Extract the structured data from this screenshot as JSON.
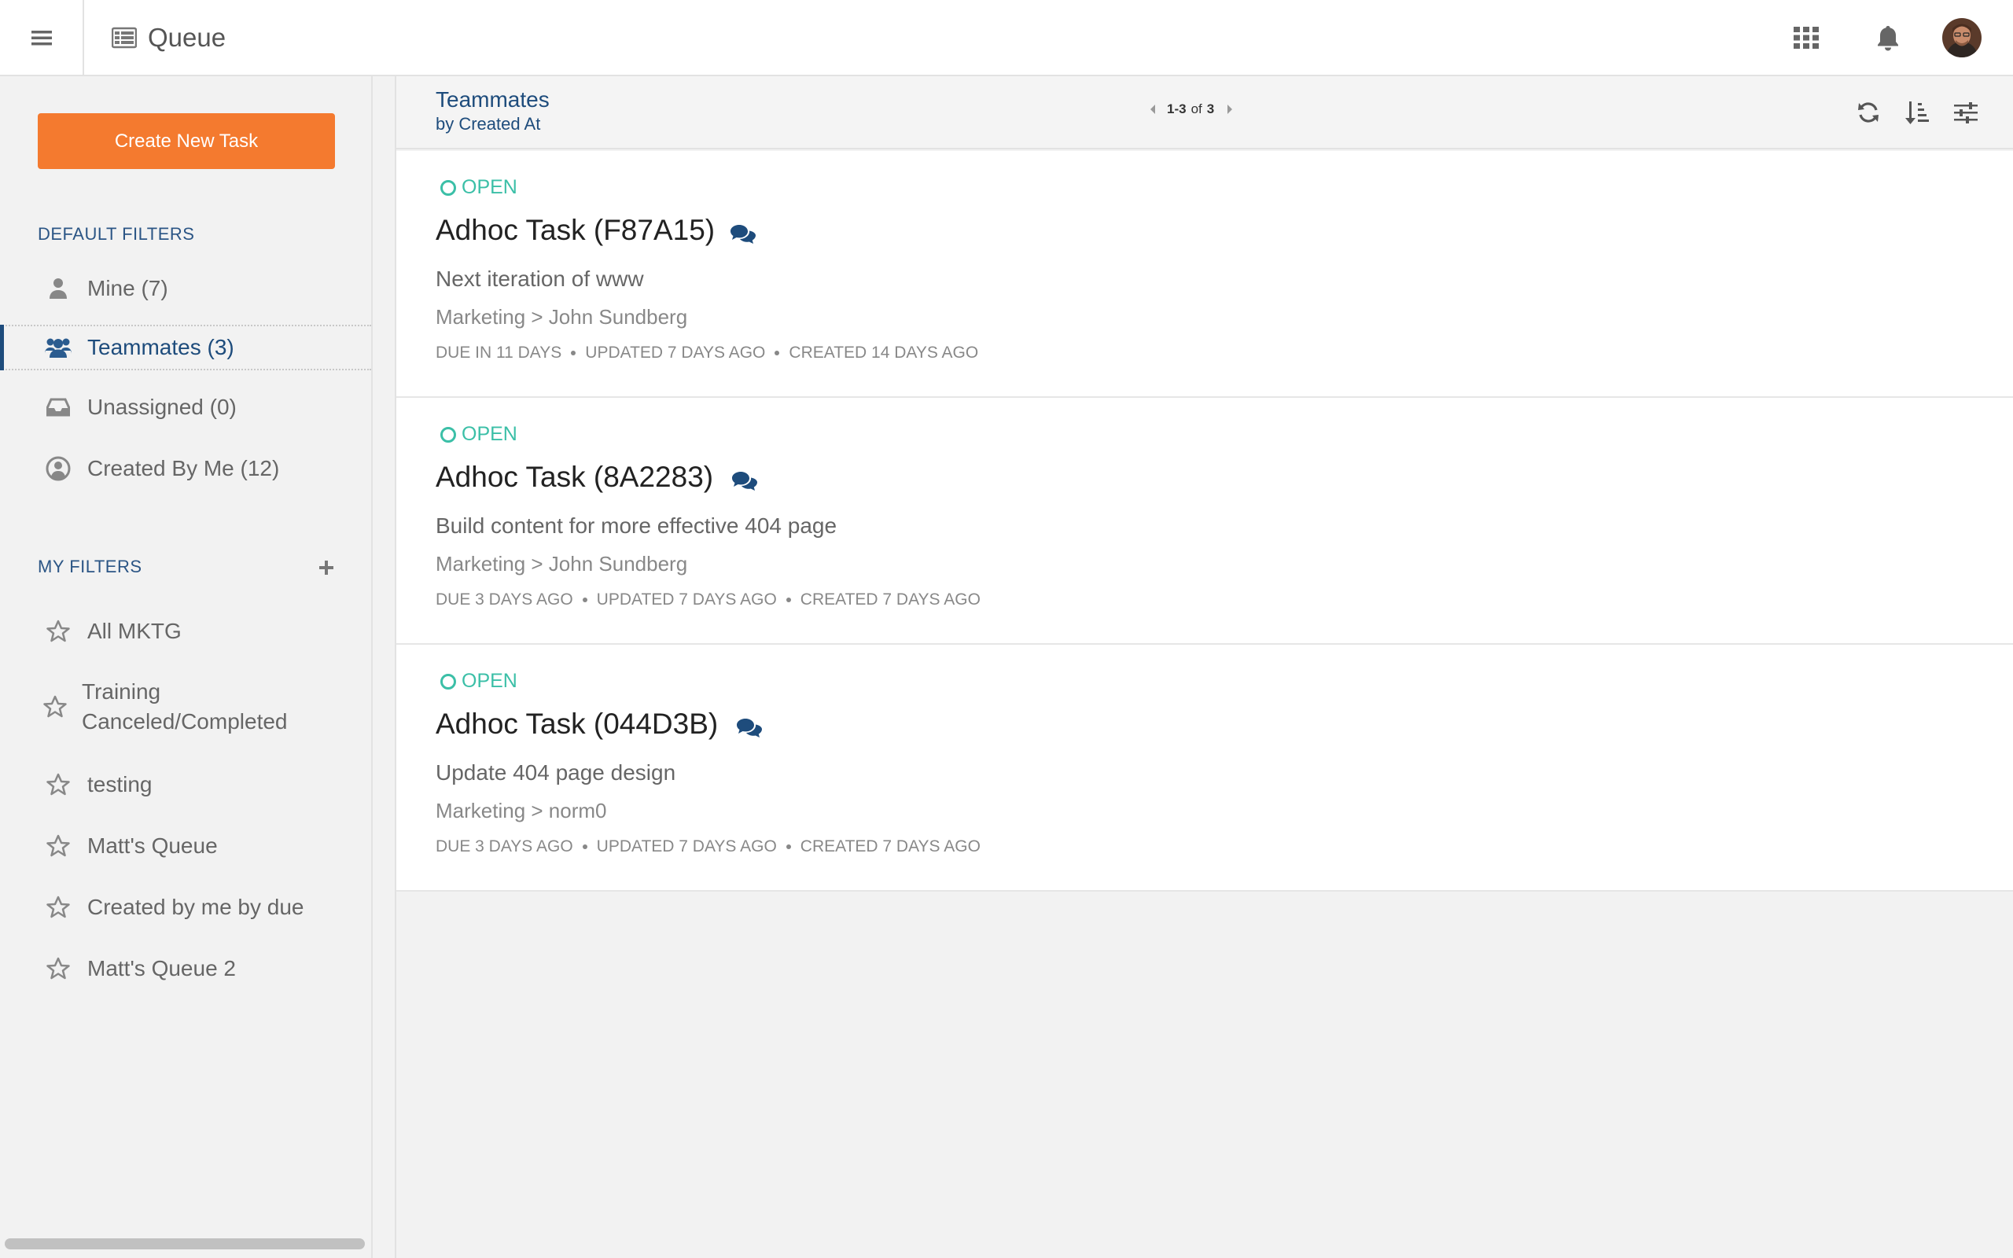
{
  "header": {
    "app_title": "Queue",
    "icons": {
      "menu": "hamburger-icon",
      "queue": "queue-icon",
      "apps": "grid-icon",
      "notifications": "bell-icon"
    }
  },
  "sidebar": {
    "create_button": "Create New Task",
    "default_filters_title": "DEFAULT FILTERS",
    "default_filters": [
      {
        "label": "Mine (7)",
        "icon": "user-icon"
      },
      {
        "label": "Teammates (3)",
        "icon": "users-icon",
        "active": true
      },
      {
        "label": "Unassigned (0)",
        "icon": "inbox-icon"
      },
      {
        "label": "Created By Me (12)",
        "icon": "user-circle-icon"
      }
    ],
    "my_filters_title": "MY FILTERS",
    "my_filters": [
      {
        "label": "All MKTG"
      },
      {
        "label_line1": "Training",
        "label_line2": "Canceled/Completed"
      },
      {
        "label": "testing"
      },
      {
        "label": "Matt's Queue"
      },
      {
        "label": "Created by me by due"
      },
      {
        "label": "Matt's Queue 2"
      }
    ]
  },
  "list_header": {
    "title": "Teammates",
    "subtitle": "by Created At",
    "pager": {
      "range": "1-3",
      "of": "of",
      "total": "3"
    }
  },
  "tasks": [
    {
      "status": "OPEN",
      "title": "Adhoc Task (F87A15)",
      "description": "Next iteration of www",
      "path": "Marketing > John Sundberg",
      "due": "DUE IN 11 DAYS",
      "updated": "UPDATED 7 DAYS AGO",
      "created": "CREATED 14 DAYS AGO"
    },
    {
      "status": "OPEN",
      "title": "Adhoc Task (8A2283)",
      "description": "Build content for more effective 404 page",
      "path": "Marketing > John Sundberg",
      "due": "DUE 3 DAYS AGO",
      "updated": "UPDATED 7 DAYS AGO",
      "created": "CREATED 7 DAYS AGO"
    },
    {
      "status": "OPEN",
      "title": "Adhoc Task (044D3B)",
      "description": "Update 404 page design",
      "path": "Marketing > norm0",
      "due": "DUE 3 DAYS AGO",
      "updated": "UPDATED 7 DAYS AGO",
      "created": "CREATED 7 DAYS AGO"
    }
  ],
  "colors": {
    "accent_orange": "#f47a2f",
    "navy": "#1e4c7c",
    "status_open": "#3bbfa7"
  }
}
